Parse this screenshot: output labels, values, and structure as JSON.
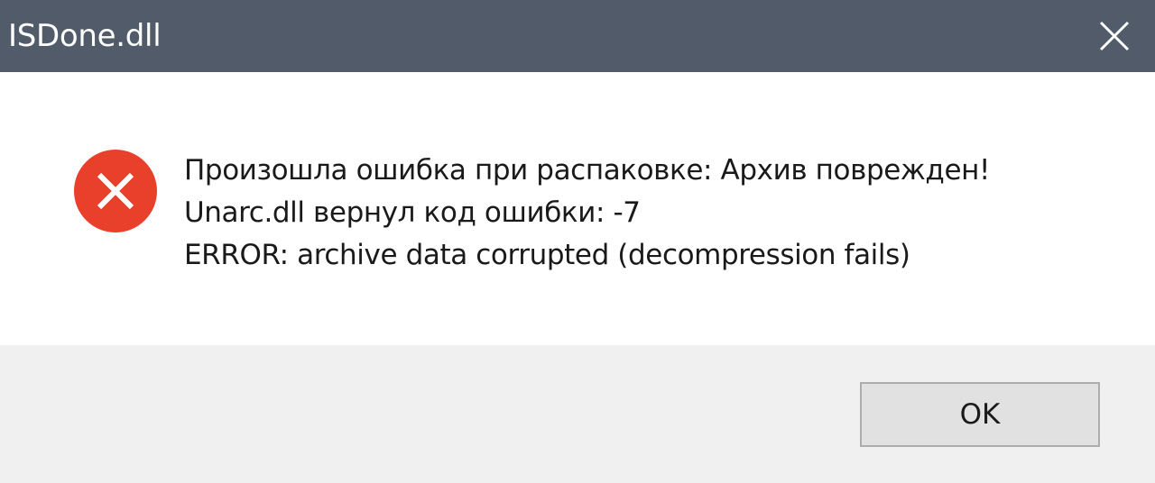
{
  "window": {
    "title": "ISDone.dll",
    "titlebar_color": "#515b6a"
  },
  "icons": {
    "close": "close-icon",
    "error": "error-icon"
  },
  "error_color": "#e8402a",
  "message": {
    "lines": [
      "Произошла ошибка при распаковке: Архив поврежден!",
      "Unarc.dll вернул код ошибки: -7",
      "ERROR: archive data corrupted (decompression fails)"
    ]
  },
  "buttons": {
    "ok_label": "OK"
  }
}
